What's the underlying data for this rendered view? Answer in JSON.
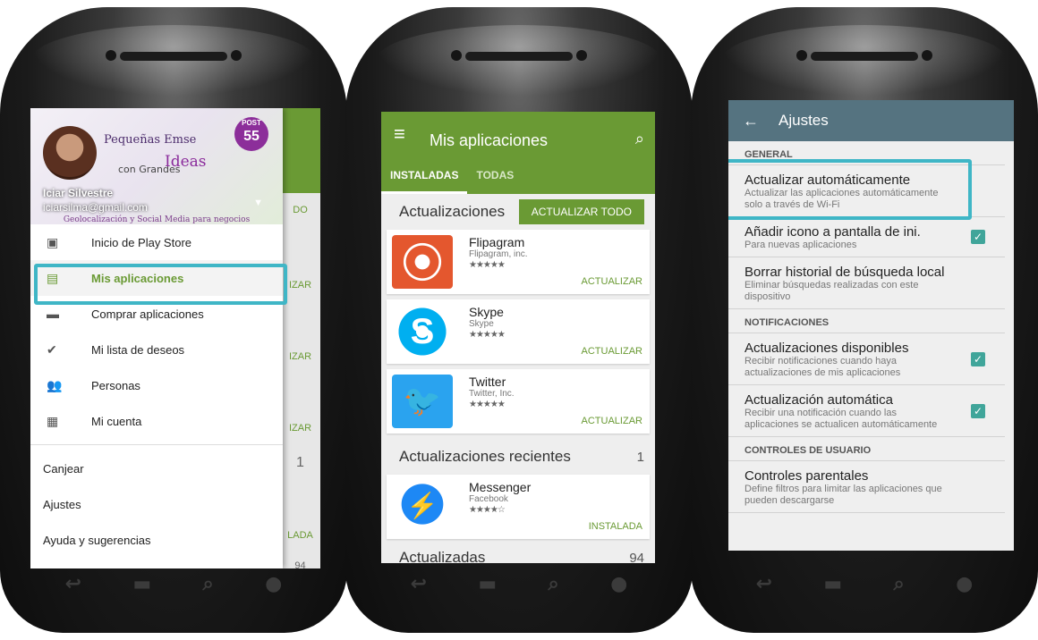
{
  "phone1": {
    "profile": {
      "name": "Iciar Silvestre",
      "email": "iciarsilma@gmail.com",
      "brand_line1": "Pequeñas Em",
      "brand_line2": "Ideas",
      "brand_line3": "con Grandes",
      "brand_suffix": "se",
      "post_label": "POST",
      "post_number": "55",
      "banner": "Geolocalización y Social Media para negocios"
    },
    "menu": [
      {
        "label": "Inicio de Play Store",
        "icon": "play-store-icon"
      },
      {
        "label": "Mis aplicaciones",
        "icon": "my-apps-icon"
      },
      {
        "label": "Comprar aplicaciones",
        "icon": "android-icon"
      },
      {
        "label": "Mi lista de deseos",
        "icon": "wishlist-icon"
      },
      {
        "label": "Personas",
        "icon": "people-icon"
      },
      {
        "label": "Mi cuenta",
        "icon": "account-icon"
      }
    ],
    "bottom": [
      "Canjear",
      "Ajustes",
      "Ayuda y sugerencias"
    ],
    "background_labels": [
      "DO",
      "IZAR",
      "IZAR",
      "IZAR",
      "1",
      "LADA",
      "94"
    ]
  },
  "phone2": {
    "title": "Mis aplicaciones",
    "tabs": [
      "INSTALADAS",
      "TODAS"
    ],
    "section_updates": "Actualizaciones",
    "update_all": "ACTUALIZAR TODO",
    "apps": [
      {
        "name": "Flipagram",
        "dev": "Flipagram, inc.",
        "stars": "★★★★★",
        "action": "ACTUALIZAR"
      },
      {
        "name": "Skype",
        "dev": "Skype",
        "stars": "★★★★★",
        "action": "ACTUALIZAR"
      },
      {
        "name": "Twitter",
        "dev": "Twitter, Inc.",
        "stars": "★★★★★",
        "action": "ACTUALIZAR"
      }
    ],
    "section_recent": "Actualizaciones recientes",
    "recent_count": "1",
    "recent_app": {
      "name": "Messenger",
      "dev": "Facebook",
      "stars": "★★★★☆",
      "action": "INSTALADA"
    },
    "section_updated": "Actualizadas",
    "updated_count": "94"
  },
  "phone3": {
    "title": "Ajustes",
    "general": "GENERAL",
    "items_general": [
      {
        "title": "Actualizar automáticamente",
        "desc": "Actualizar las aplicaciones automáticamente solo a través de Wi-Fi"
      },
      {
        "title": "Añadir icono a pantalla de ini.",
        "desc": "Para nuevas aplicaciones"
      },
      {
        "title": "Borrar historial de búsqueda local",
        "desc": "Eliminar búsquedas realizadas con este dispositivo"
      }
    ],
    "notifications": "NOTIFICACIONES",
    "items_notif": [
      {
        "title": "Actualizaciones disponibles",
        "desc": "Recibir notificaciones cuando haya actualizaciones de mis aplicaciones"
      },
      {
        "title": "Actualización automática",
        "desc": "Recibir una notificación cuando las aplicaciones se actualicen automáticamente"
      }
    ],
    "user_controls": "CONTROLES DE USUARIO",
    "items_user": [
      {
        "title": "Controles parentales",
        "desc": "Define filtros para limitar las aplicaciones que pueden descargarse"
      }
    ]
  },
  "colors": {
    "play_green": "#6a9a34",
    "highlight": "#3fb6c6",
    "settings_bar": "#557380",
    "checkbox": "#40a59a"
  }
}
